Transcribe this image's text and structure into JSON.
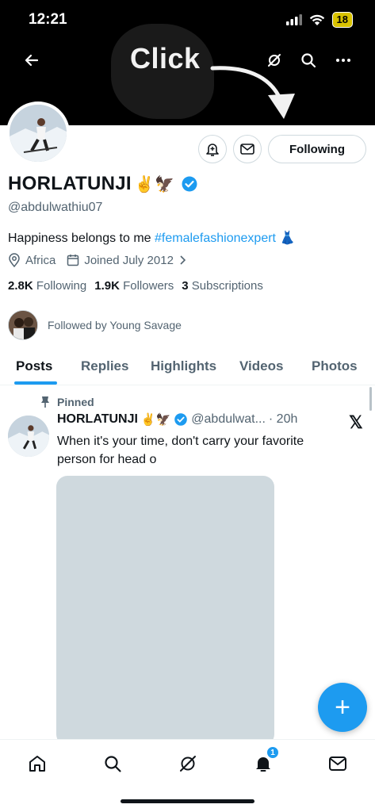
{
  "status_bar": {
    "time": "12:21",
    "battery": "18"
  },
  "overlay": {
    "click_label": "Click"
  },
  "profile": {
    "name": "HORLATUNJI",
    "name_emoji": "✌️🦅",
    "handle": "@abdulwathiu07",
    "bio_text": "Happiness belongs to me ",
    "bio_hashtag": "#femalefashionexpert",
    "bio_emoji": "👗",
    "location": "Africa",
    "joined": "Joined July 2012",
    "following_count": "2.8K",
    "following_label": "Following",
    "followers_count": "1.9K",
    "followers_label": "Followers",
    "subscriptions_count": "3",
    "subscriptions_label": "Subscriptions",
    "followed_by": "Followed by Young Savage",
    "following_button": "Following"
  },
  "tabs": [
    {
      "label": "Posts"
    },
    {
      "label": "Replies"
    },
    {
      "label": "Highlights"
    },
    {
      "label": "Videos"
    },
    {
      "label": "Photos"
    }
  ],
  "pinned_post": {
    "pinned_label": "Pinned",
    "author": "HORLATUNJI",
    "author_emoji": "✌️🦅",
    "handle": "@abdulwat...",
    "time": "· 20h",
    "text": "When it's your time, don't carry your favorite person for head o"
  },
  "fab": {
    "label": "+"
  },
  "bottom_nav": {
    "items": [
      {
        "icon": "home-icon"
      },
      {
        "icon": "search-icon"
      },
      {
        "icon": "grok-icon"
      },
      {
        "icon": "bell-icon",
        "badge": "1"
      },
      {
        "icon": "mail-icon"
      }
    ]
  },
  "colors": {
    "accent": "#1d9bf0",
    "banner": "#000000",
    "muted": "#536471",
    "media": "#cfd9de"
  }
}
